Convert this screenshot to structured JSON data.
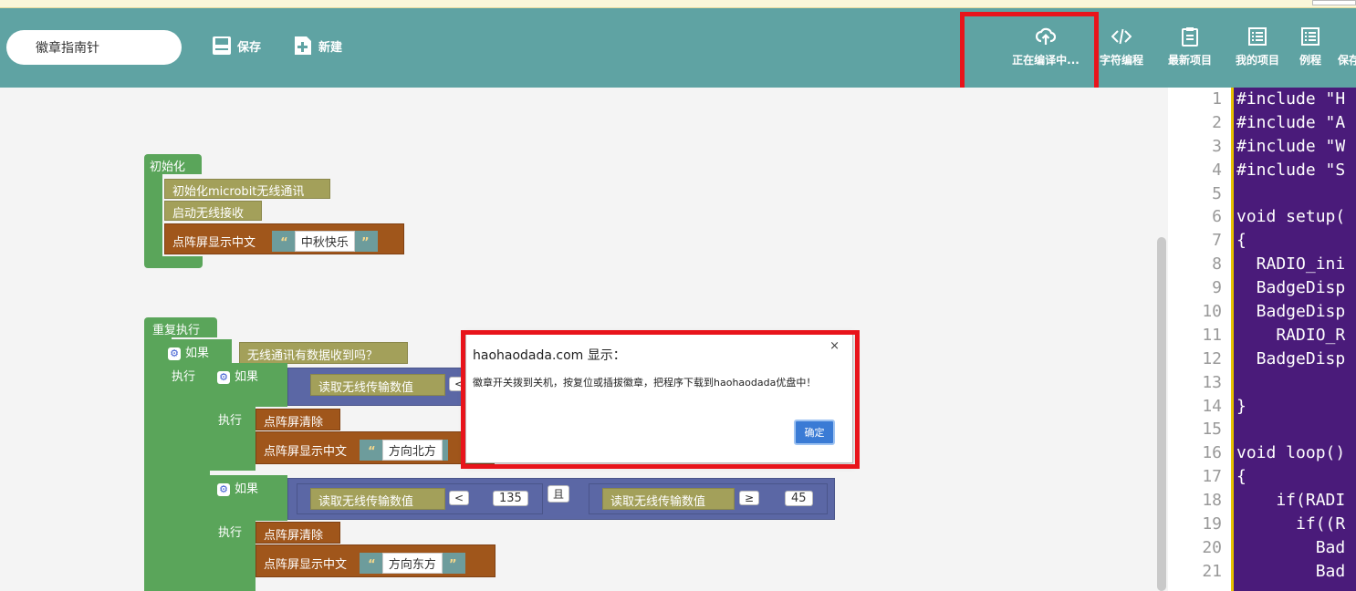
{
  "header": {
    "project_name": "徽章指南针",
    "save_label": "保存",
    "new_label": "新建",
    "compile_label": "正在编译中...",
    "char_prog_label": "字符编程",
    "latest_label": "最新项目",
    "mine_label": "我的项目",
    "example_label": "例程",
    "save2_label": "保存"
  },
  "colors": {
    "header_bg": "#5fa3a3",
    "highlight": "#e8141b",
    "code_bg": "#4a1b7a"
  },
  "blocks": {
    "init_hat": "初始化",
    "init_radio": "初始化microbit无线通讯",
    "start_rx": "启动无线接收",
    "show_cn": "点阵屏显示中文",
    "text1": "中秋快乐",
    "repeat_hat": "重复执行",
    "if_label": "如果",
    "exec_label": "执行",
    "radio_has_data": "无线通讯有数据收到吗？",
    "read_radio": "读取无线传输数值",
    "clear_screen": "点阵屏清除",
    "text_north": "方向北方",
    "text_east": "方向东方",
    "op_lt": "<",
    "op_ge": "≥",
    "and_label": "且",
    "num_135": "135",
    "num_45": "45"
  },
  "dialog": {
    "title": "haohaodada.com 显示：",
    "message": "徽章开关拨到关机，按复位或插拔徽章，把程序下载到haohaodada优盘中！",
    "ok_label": "确定",
    "close_glyph": "×"
  },
  "code": {
    "line_numbers": [
      "1",
      "2",
      "3",
      "4",
      "5",
      "6",
      "7",
      "8",
      "9",
      "10",
      "11",
      "12",
      "13",
      "14",
      "15",
      "16",
      "17",
      "18",
      "19",
      "20",
      "21"
    ],
    "lines": [
      "#include \"H",
      "#include \"A",
      "#include \"W",
      "#include \"S",
      "",
      "void setup(",
      "{",
      "  RADIO_ini",
      "  BadgeDisp",
      "  BadgeDisp",
      "    RADIO_R",
      "  BadgeDisp",
      "",
      "}",
      "",
      "void loop()",
      "{",
      "    if(RADI",
      "      if((R",
      "        Bad",
      "        Bad"
    ]
  }
}
